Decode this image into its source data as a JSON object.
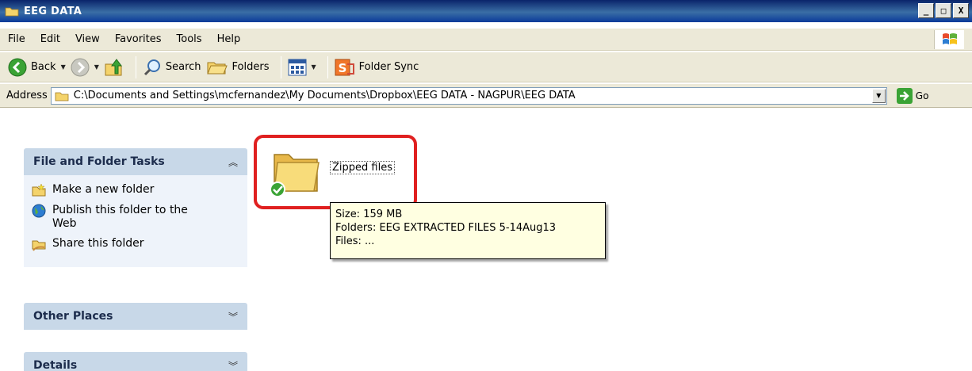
{
  "window": {
    "title": "EEG DATA",
    "min_label": "_",
    "max_label": "□",
    "close_label": "X"
  },
  "menu": {
    "items": [
      "File",
      "Edit",
      "View",
      "Favorites",
      "Tools",
      "Help"
    ]
  },
  "toolbar": {
    "back": "Back",
    "search": "Search",
    "folders": "Folders",
    "sync": "Folder Sync"
  },
  "address": {
    "label": "Address",
    "path": "C:\\Documents and Settings\\mcfernandez\\My Documents\\Dropbox\\EEG DATA - NAGPUR\\EEG DATA",
    "go": "Go"
  },
  "tasks": {
    "title": "File and Folder Tasks",
    "items": [
      "Make a new folder",
      "Publish this folder to the Web",
      "Share this folder"
    ]
  },
  "other_places": {
    "title": "Other Places"
  },
  "details": {
    "title": "Details"
  },
  "content": {
    "folder_name": "Zipped files",
    "tooltip": {
      "size": "Size: 159 MB",
      "folders": "Folders: EEG EXTRACTED FILES 5-14Aug13",
      "files": "Files: ..."
    }
  },
  "colors": {
    "title_bar": "#0a246a",
    "highlight": "#e02020",
    "tooltip_bg": "#ffffe1",
    "pane_header": "#c8d8e8"
  }
}
